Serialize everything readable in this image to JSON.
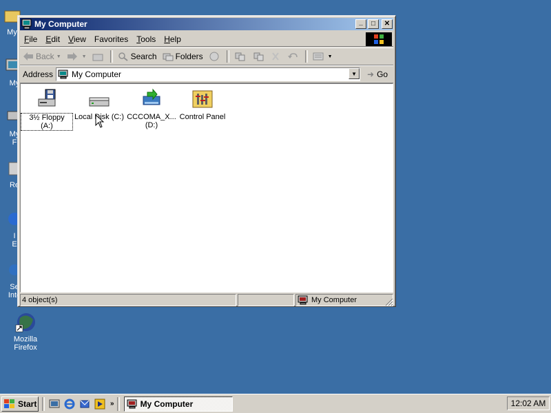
{
  "desktop": {
    "icons": [
      {
        "label": "My D"
      },
      {
        "label": "My"
      },
      {
        "label": "My\nF"
      },
      {
        "label": "Re"
      },
      {
        "label": "I\nE"
      },
      {
        "label": "Se\nInte"
      },
      {
        "label": "Mozilla Firefox"
      }
    ]
  },
  "window": {
    "title": "My Computer",
    "controls": {
      "minimize": "_",
      "maximize": "□",
      "close": "✕"
    },
    "menu": [
      {
        "label": "File",
        "accel": "F",
        "rest": "ile"
      },
      {
        "label": "Edit",
        "accel": "E",
        "rest": "dit"
      },
      {
        "label": "View",
        "accel": "V",
        "rest": "iew"
      },
      {
        "label": "Favorites",
        "accel": "F",
        "rest": "avorites",
        "prefix": "F"
      },
      {
        "label": "Tools",
        "accel": "T",
        "rest": "ools"
      },
      {
        "label": "Help",
        "accel": "H",
        "rest": "elp"
      }
    ],
    "toolbar": {
      "back": "Back",
      "search": "Search",
      "folders": "Folders"
    },
    "address": {
      "label": "Address",
      "value": "My Computer",
      "go": "Go"
    },
    "items": [
      {
        "label": "3½ Floppy (A:)",
        "icon": "floppy-drive-icon",
        "selected": true
      },
      {
        "label": "Local Disk (C:)",
        "icon": "hard-disk-icon",
        "selected": false
      },
      {
        "label": "CCCOMA_X...",
        "label2": "(D:)",
        "icon": "cd-drive-icon",
        "selected": false
      },
      {
        "label": "Control Panel",
        "icon": "control-panel-icon",
        "selected": false
      }
    ],
    "status": {
      "objects": "4 object(s)",
      "zone": "My Computer"
    }
  },
  "taskbar": {
    "start": "Start",
    "task": "My Computer",
    "chevron": "»",
    "clock": "12:02 AM"
  },
  "colors": {
    "desktop": "#3a6ea5",
    "title_start": "#0a246a",
    "title_end": "#a6caf0",
    "face": "#d4d0c8"
  }
}
